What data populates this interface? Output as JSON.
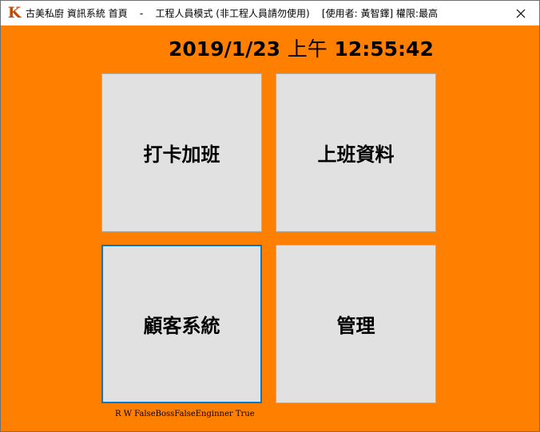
{
  "window": {
    "title": "古美私廚 資訊系統 首頁    -    工程人員模式 (非工程人員請勿使用)    [使用者: 黃智鐸] 權限:最高",
    "icon": "brand-k-icon",
    "close_icon": "close-icon"
  },
  "clock": {
    "date": "2019/1/23",
    "ampm": "上午",
    "time": "12:55:42"
  },
  "tiles": {
    "punch_overtime": "打卡加班",
    "work_data": "上班資料",
    "customer_system": "顧客系統",
    "management": "管理"
  },
  "status_text": "R W FalseBossFalseEnginner True",
  "colors": {
    "background": "#ff8000",
    "tile": "#e1e1e1",
    "focus_border": "#0078d7"
  }
}
